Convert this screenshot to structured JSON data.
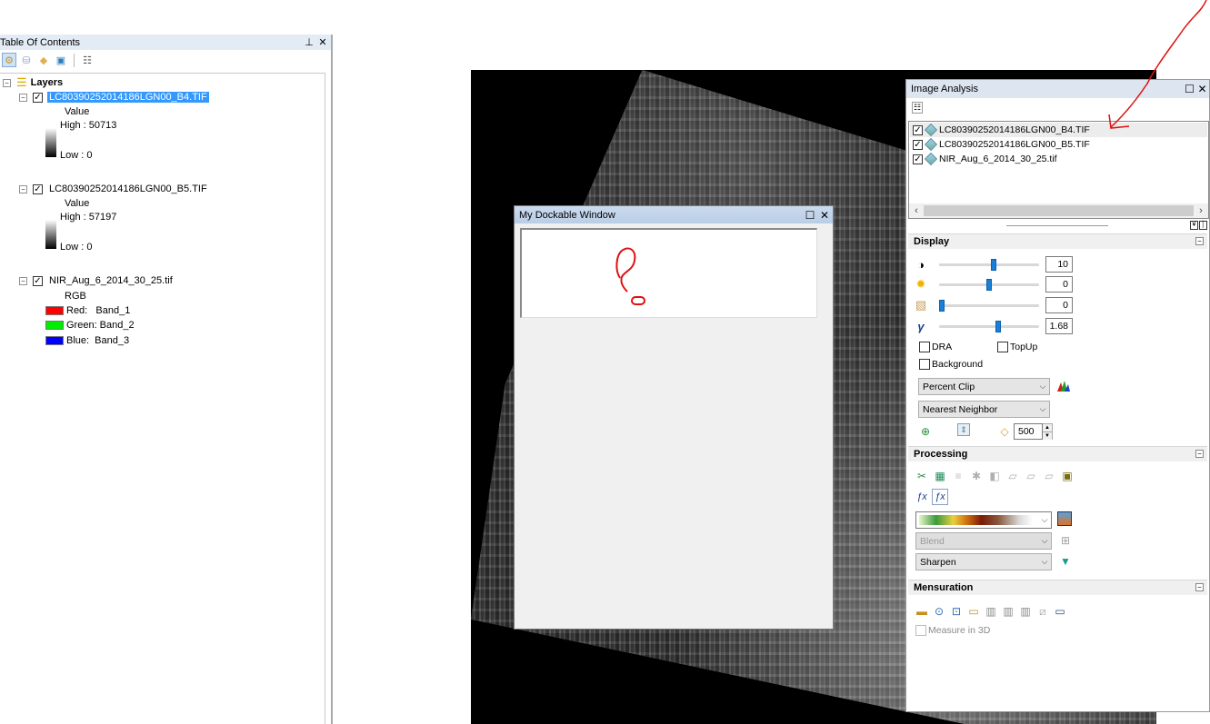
{
  "toc": {
    "title": "Table Of Contents",
    "pin_icon": "pin-icon",
    "close_icon": "close-icon",
    "toolbar": [
      {
        "name": "list-by-drawing-order-icon",
        "glyph": "⚙"
      },
      {
        "name": "list-by-source-icon",
        "glyph": "▼"
      },
      {
        "name": "list-by-visibility-icon",
        "glyph": "◆"
      },
      {
        "name": "list-by-selection-icon",
        "glyph": "▣"
      },
      {
        "name": "options-icon",
        "glyph": "☰"
      }
    ],
    "root": {
      "label": "Layers",
      "icon": "layers-icon"
    },
    "layers": [
      {
        "name": "LC80390252014186LGN00_B4.TIF",
        "checked": true,
        "selected": true,
        "legend_type": "stretched",
        "legend_title": "Value",
        "high": "High : 50713",
        "low": "Low : 0"
      },
      {
        "name": "LC80390252014186LGN00_B5.TIF",
        "checked": true,
        "selected": false,
        "legend_type": "stretched",
        "legend_title": "Value",
        "high": "High : 57197",
        "low": "Low : 0"
      },
      {
        "name": "NIR_Aug_6_2014_30_25.tif",
        "checked": true,
        "selected": false,
        "legend_type": "rgb",
        "legend_title": "RGB",
        "bands": [
          {
            "label": "Red:   Band_1",
            "color": "#ff0000"
          },
          {
            "label": "Green: Band_2",
            "color": "#00ee00"
          },
          {
            "label": "Blue:  Band_3",
            "color": "#0000ff"
          }
        ]
      }
    ]
  },
  "dockable_window": {
    "title": "My Dockable Window",
    "maximize_icon": "maximize-icon",
    "close_icon": "close-icon"
  },
  "image_analysis": {
    "title": "Image Analysis",
    "layers": [
      {
        "name": "LC80390252014186LGN00_B4.TIF",
        "checked": true,
        "highlighted": true
      },
      {
        "name": "LC80390252014186LGN00_B5.TIF",
        "checked": true,
        "highlighted": false
      },
      {
        "name": "NIR_Aug_6_2014_30_25.tif",
        "checked": true,
        "highlighted": false
      }
    ],
    "display": {
      "title": "Display",
      "sliders": [
        {
          "name": "contrast",
          "icon": "contrast-icon",
          "glyph": "◑",
          "value": "10",
          "fraction": 0.55
        },
        {
          "name": "brightness",
          "icon": "brightness-icon",
          "glyph": "✹",
          "value": "0",
          "fraction": 0.5
        },
        {
          "name": "transparency",
          "icon": "transparency-icon",
          "glyph": "▧",
          "value": "0",
          "fraction": 0.0
        },
        {
          "name": "gamma",
          "icon": "gamma-icon",
          "glyph": "γ",
          "value": "1.68",
          "fraction": 0.6
        }
      ],
      "dra_label": "DRA",
      "dra_checked": false,
      "topup_label": "TopUp",
      "topup_checked": false,
      "background_label": "Background",
      "background_checked": false,
      "stretch_type": "Percent Clip",
      "resampling": "Nearest Neighbor",
      "scale_value": "500"
    },
    "processing": {
      "title": "Processing",
      "tools": [
        {
          "name": "clip-icon",
          "glyph": "✂",
          "enabled": true
        },
        {
          "name": "mask-icon",
          "glyph": "▦",
          "enabled": true
        },
        {
          "name": "mosaic-icon",
          "glyph": "≡",
          "enabled": false
        },
        {
          "name": "ndvi-icon",
          "glyph": "✱",
          "enabled": false
        },
        {
          "name": "difference-icon",
          "glyph": "◧",
          "enabled": false
        },
        {
          "name": "orthorectify-icon",
          "glyph": "▱",
          "enabled": false
        },
        {
          "name": "hillshade-icon",
          "glyph": "▱",
          "enabled": false
        },
        {
          "name": "shaded-relief-icon",
          "glyph": "▱",
          "enabled": false
        },
        {
          "name": "export-icon",
          "glyph": "▪",
          "enabled": true
        }
      ],
      "function_tools": [
        {
          "name": "add-function-icon",
          "glyph": "ƒx"
        },
        {
          "name": "function-editor-icon",
          "glyph": "ƒx"
        }
      ],
      "color_ramp": "elevation",
      "blend": "Blend",
      "sharpen": "Sharpen"
    },
    "mensuration": {
      "title": "Mensuration",
      "tools": [
        {
          "name": "measure-distance-icon",
          "glyph": "▬"
        },
        {
          "name": "measure-point-icon",
          "glyph": "⊙"
        },
        {
          "name": "measure-centroid-icon",
          "glyph": "⊡"
        },
        {
          "name": "measure-area-icon",
          "glyph": "▭"
        },
        {
          "name": "height-base-top-icon",
          "glyph": "▥"
        },
        {
          "name": "height-base-shadow-icon",
          "glyph": "▥"
        },
        {
          "name": "height-top-shadow-icon",
          "glyph": "▥"
        },
        {
          "name": "clear-measurements-icon",
          "glyph": "⧄"
        },
        {
          "name": "settings-icon",
          "glyph": "▭"
        }
      ],
      "measure_3d_label": "Measure in 3D",
      "measure_3d_checked": false
    }
  },
  "colors": {
    "selection": "#3399ff",
    "titlebar_blue": "#c3d5eb",
    "slider_thumb": "#1a7fd8",
    "annotation_red": "#e01010"
  }
}
